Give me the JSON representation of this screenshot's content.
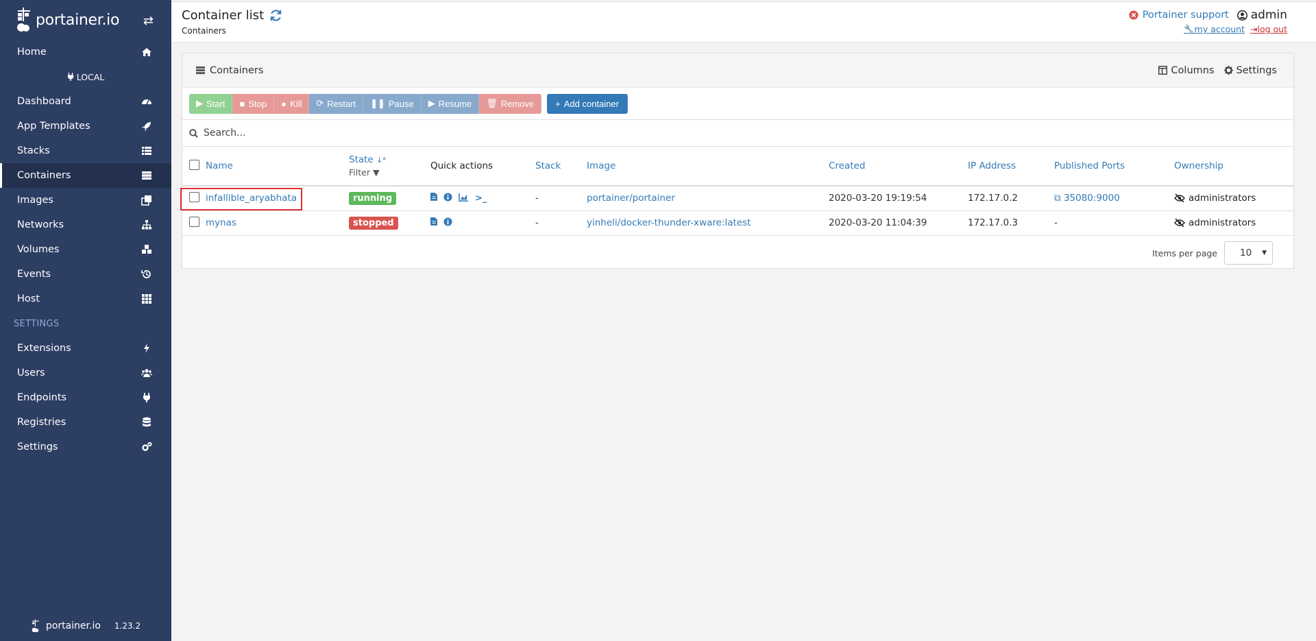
{
  "brand": {
    "name": "portainer.io",
    "version": "1.23.2"
  },
  "sidebar": {
    "home": "Home",
    "endpoint": "LOCAL",
    "items": [
      {
        "label": "Dashboard",
        "icon": "tachometer-icon"
      },
      {
        "label": "App Templates",
        "icon": "rocket-icon"
      },
      {
        "label": "Stacks",
        "icon": "th-list-icon"
      },
      {
        "label": "Containers",
        "icon": "server-icon",
        "active": true
      },
      {
        "label": "Images",
        "icon": "clone-icon"
      },
      {
        "label": "Networks",
        "icon": "sitemap-icon"
      },
      {
        "label": "Volumes",
        "icon": "cubes-icon"
      },
      {
        "label": "Events",
        "icon": "history-icon"
      },
      {
        "label": "Host",
        "icon": "th-icon"
      }
    ],
    "section": "SETTINGS",
    "settings_items": [
      {
        "label": "Extensions",
        "icon": "bolt-icon"
      },
      {
        "label": "Users",
        "icon": "users-icon"
      },
      {
        "label": "Endpoints",
        "icon": "plug-icon"
      },
      {
        "label": "Registries",
        "icon": "database-icon"
      },
      {
        "label": "Settings",
        "icon": "cogs-icon"
      }
    ]
  },
  "header": {
    "title": "Container list",
    "breadcrumb": "Containers",
    "support": "Portainer support",
    "user": "admin",
    "my_account": "my account",
    "log_out": "log out"
  },
  "panel": {
    "title": "Containers",
    "columns": "Columns",
    "settings": "Settings",
    "actions": {
      "start": "Start",
      "stop": "Stop",
      "kill": "Kill",
      "restart": "Restart",
      "pause": "Pause",
      "resume": "Resume",
      "remove": "Remove",
      "add": "Add container"
    },
    "search_placeholder": "Search...",
    "headers": {
      "name": "Name",
      "state": "State",
      "filter": "Filter",
      "quick_actions": "Quick actions",
      "stack": "Stack",
      "image": "Image",
      "created": "Created",
      "ip": "IP Address",
      "ports": "Published Ports",
      "ownership": "Ownership"
    },
    "rows": [
      {
        "name": "infallible_aryabhata",
        "state": "running",
        "stack": "-",
        "image": "portainer/portainer",
        "created": "2020-03-20 19:19:54",
        "ip": "172.17.0.2",
        "ports": "35080:9000",
        "ownership": "administrators"
      },
      {
        "name": "mynas",
        "state": "stopped",
        "stack": "-",
        "image": "yinheli/docker-thunder-xware:latest",
        "created": "2020-03-20 11:04:39",
        "ip": "172.17.0.3",
        "ports": "-",
        "ownership": "administrators"
      }
    ],
    "items_per_page_label": "Items per page",
    "items_per_page": "10"
  },
  "colors": {
    "sidebar": "#2d3e63",
    "link": "#337ab7",
    "running": "#5cb85c",
    "stopped": "#d9534f"
  }
}
